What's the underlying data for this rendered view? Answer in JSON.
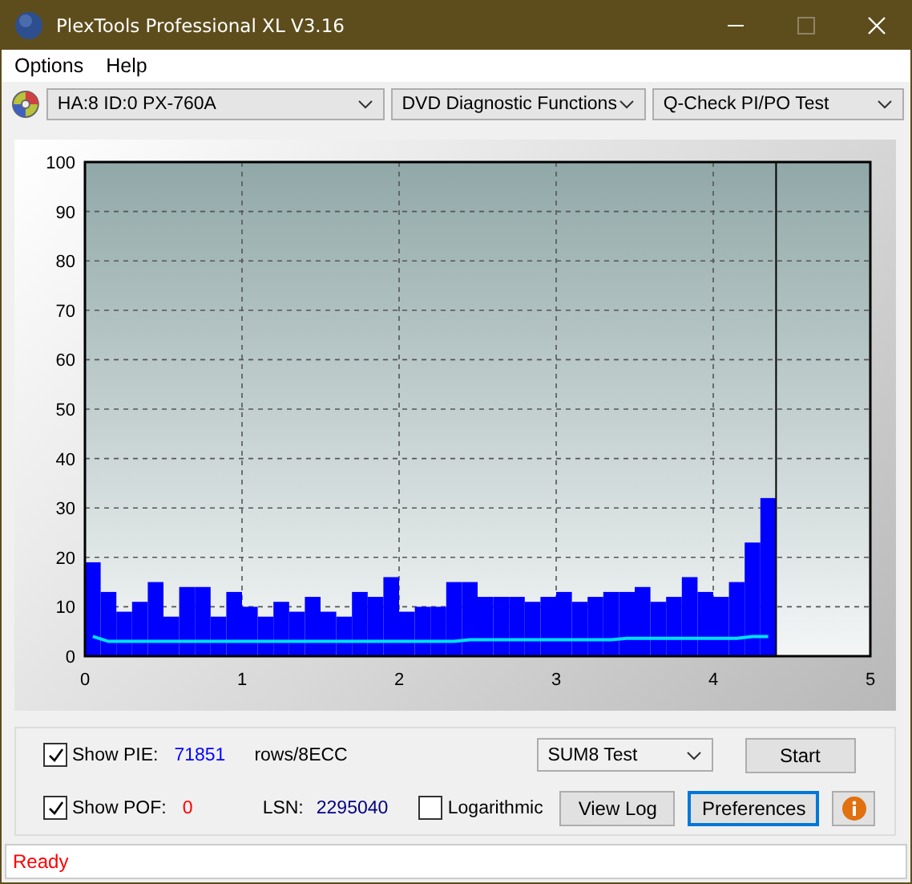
{
  "window": {
    "title": "PlexTools Professional XL V3.16"
  },
  "menu": [
    "Options",
    "Help"
  ],
  "toolbar": {
    "drive": "HA:8 ID:0  PX-760A",
    "function": "DVD Diagnostic Functions",
    "test": "Q-Check PI/PO Test"
  },
  "chart": {
    "chart_data": {
      "type": "bar",
      "grid": true,
      "ref_lines": [
        {
          "axis": "x",
          "value": 4.4,
          "color": "#000000"
        }
      ],
      "xlim": [
        0,
        5
      ],
      "ylim": [
        0,
        100
      ],
      "xticks": [
        0,
        1,
        2,
        3,
        4,
        5
      ],
      "yticks": [
        0,
        10,
        20,
        30,
        40,
        50,
        60,
        70,
        80,
        90,
        100
      ],
      "x": [
        0.05,
        0.15,
        0.25,
        0.35,
        0.45,
        0.55,
        0.65,
        0.75,
        0.85,
        0.95,
        1.05,
        1.15,
        1.25,
        1.35,
        1.45,
        1.55,
        1.65,
        1.75,
        1.85,
        1.95,
        2.05,
        2.15,
        2.25,
        2.35,
        2.45,
        2.55,
        2.65,
        2.75,
        2.85,
        2.95,
        3.05,
        3.15,
        3.25,
        3.35,
        3.45,
        3.55,
        3.65,
        3.75,
        3.85,
        3.95,
        4.05,
        4.15,
        4.25,
        4.35
      ],
      "series": [
        {
          "color": "#0000ff",
          "values": [
            19,
            13,
            9,
            11,
            15,
            8,
            14,
            14,
            8,
            13,
            10,
            8,
            11,
            9,
            12,
            9,
            8,
            13,
            12,
            16,
            9,
            10,
            10,
            15,
            15,
            12,
            12,
            12,
            11,
            12,
            13,
            11,
            12,
            13,
            13,
            14,
            11,
            12,
            16,
            13,
            12,
            15,
            23,
            32
          ]
        },
        {
          "type": "line",
          "color": "#00e0ff",
          "values": [
            4,
            3,
            3,
            3,
            3,
            3,
            3,
            3,
            3,
            3,
            3,
            3,
            3,
            3,
            3,
            3,
            3,
            3,
            3,
            3,
            3,
            3,
            3,
            3,
            3.3,
            3.3,
            3.3,
            3.3,
            3.3,
            3.3,
            3.3,
            3.3,
            3.3,
            3.3,
            3.6,
            3.6,
            3.6,
            3.6,
            3.6,
            3.6,
            3.6,
            3.6,
            4,
            4
          ]
        }
      ]
    }
  },
  "controls": {
    "show_pie": {
      "label": "Show PIE:",
      "checked": true
    },
    "pie_value": "71851",
    "pie_unit": "rows/8ECC",
    "show_pof": {
      "label": "Show POF:",
      "checked": true
    },
    "pof_value": "0",
    "lsn_label": "LSN:",
    "lsn_value": "2295040",
    "logarithmic": {
      "label": "Logarithmic",
      "checked": false
    },
    "test_select": "SUM8 Test",
    "buttons": [
      {
        "label": "Start",
        "kind": "plain"
      },
      {
        "label": "View Log",
        "kind": "plain"
      },
      {
        "label": "Preferences",
        "kind": "focused"
      }
    ]
  },
  "status_bar": "Ready"
}
